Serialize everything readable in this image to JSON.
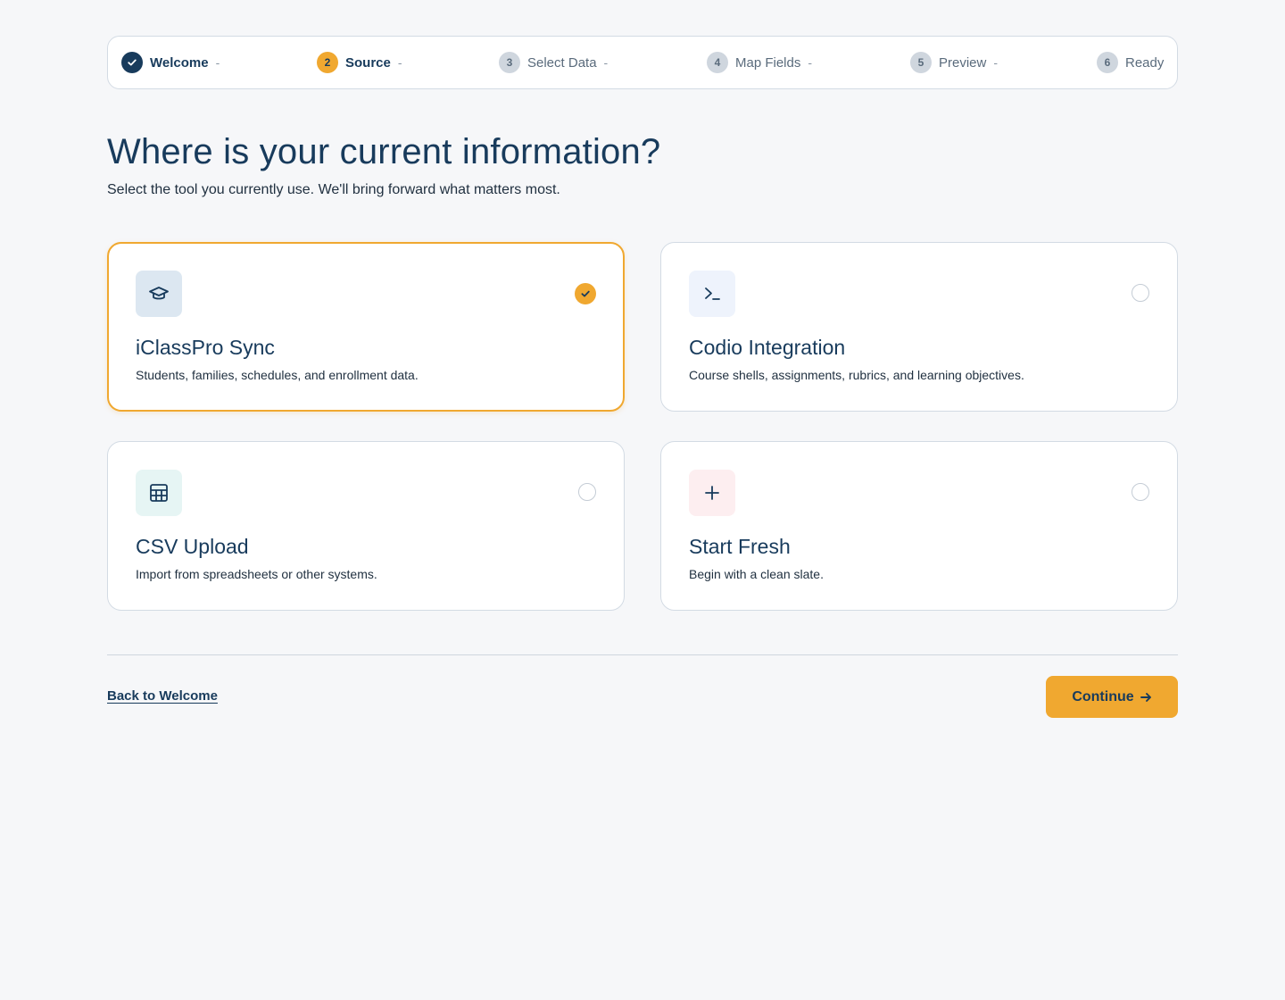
{
  "stepper": {
    "steps": [
      {
        "number": "1",
        "label": "Welcome",
        "state": "done"
      },
      {
        "number": "2",
        "label": "Source",
        "state": "active"
      },
      {
        "number": "3",
        "label": "Select Data",
        "state": "pending"
      },
      {
        "number": "4",
        "label": "Map Fields",
        "state": "pending"
      },
      {
        "number": "5",
        "label": "Preview",
        "state": "pending"
      },
      {
        "number": "6",
        "label": "Ready",
        "state": "pending"
      }
    ],
    "separator": "-"
  },
  "page": {
    "title": "Where is your current information?",
    "subtitle": "Select the tool you currently use. We'll bring forward what matters most."
  },
  "options": [
    {
      "title": "iClassPro Sync",
      "description": "Students, families, schedules, and enrollment data.",
      "icon": "graduation-cap-icon",
      "icon_bg": "#dce7f1",
      "selected": true
    },
    {
      "title": "Codio Integration",
      "description": "Course shells, assignments, rubrics, and learning objectives.",
      "icon": "terminal-icon",
      "icon_bg": "#eef3fc",
      "selected": false
    },
    {
      "title": "CSV Upload",
      "description": "Import from spreadsheets or other systems.",
      "icon": "table-icon",
      "icon_bg": "#e6f5f4",
      "selected": false
    },
    {
      "title": "Start Fresh",
      "description": "Begin with a clean slate.",
      "icon": "plus-icon",
      "icon_bg": "#fdeef0",
      "selected": false
    }
  ],
  "footer": {
    "back_label": "Back to Welcome",
    "continue_label": "Continue"
  },
  "colors": {
    "accent": "#f0a830",
    "primary": "#183b5c",
    "background": "#f6f7f9"
  }
}
